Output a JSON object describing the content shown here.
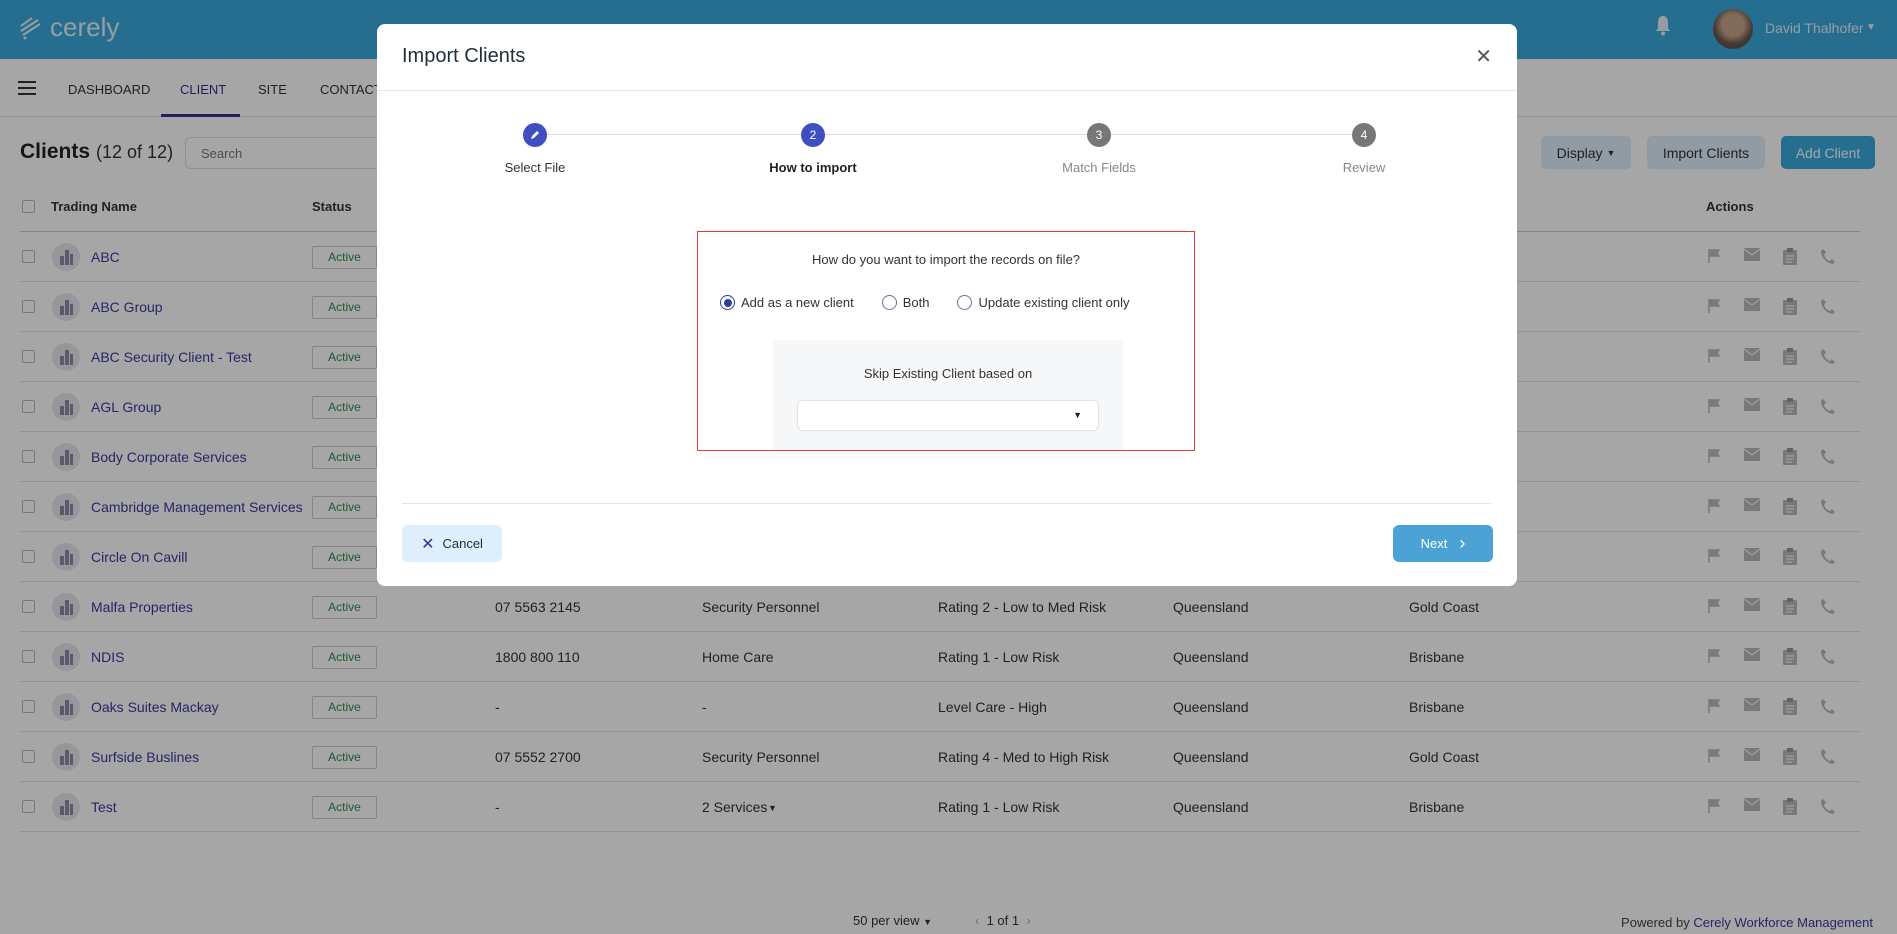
{
  "app": {
    "logo": "cerely",
    "user_name": "David Thalhofer"
  },
  "nav": {
    "items": [
      "DASHBOARD",
      "CLIENT",
      "SITE",
      "CONTACT"
    ],
    "active": "CLIENT"
  },
  "page": {
    "title": "Clients",
    "count": "(12 of 12)",
    "search_placeholder": "Search",
    "display_label": "Display",
    "import_label": "Import Clients",
    "add_label": "Add Client"
  },
  "table": {
    "headers": {
      "name": "Trading Name",
      "status": "Status",
      "actions": "Actions"
    },
    "rows": [
      {
        "name": "ABC",
        "status": "Active"
      },
      {
        "name": "ABC Group",
        "status": "Active"
      },
      {
        "name": "ABC Security Client - Test",
        "status": "Active"
      },
      {
        "name": "AGL Group",
        "status": "Active"
      },
      {
        "name": "Body Corporate Services",
        "status": "Active"
      },
      {
        "name": "Cambridge Management Services",
        "status": "Active"
      },
      {
        "name": "Circle On Cavill",
        "status": "Active"
      },
      {
        "name": "Malfa Properties",
        "status": "Active",
        "phone": "07 5563 2145",
        "industry": "Security Personnel",
        "rating": "Rating 2 - Low to Med Risk",
        "state": "Queensland",
        "city": "Gold Coast"
      },
      {
        "name": "NDIS",
        "status": "Active",
        "phone": "1800 800 110",
        "industry": "Home Care",
        "rating": "Rating 1 - Low Risk",
        "state": "Queensland",
        "city": "Brisbane"
      },
      {
        "name": "Oaks Suites Mackay",
        "status": "Active",
        "phone": "-",
        "industry": "-",
        "rating": "Level Care - High",
        "state": "Queensland",
        "city": "Brisbane"
      },
      {
        "name": "Surfside Buslines",
        "status": "Active",
        "phone": "07 5552 2700",
        "industry": "Security Personnel",
        "rating": "Rating 4 - Med to High Risk",
        "state": "Queensland",
        "city": "Gold Coast"
      },
      {
        "name": "Test",
        "status": "Active",
        "phone": "-",
        "industry": "2 Services",
        "rating": "Rating 1 - Low Risk",
        "state": "Queensland",
        "city": "Brisbane"
      }
    ]
  },
  "footer": {
    "per_view": "50 per view",
    "pagination": "1 of 1",
    "powered_prefix": "Powered by",
    "powered_link": "Cerely Workforce Management"
  },
  "modal": {
    "title": "Import Clients",
    "steps": [
      {
        "num": "1",
        "label": "Select File",
        "state": "done"
      },
      {
        "num": "2",
        "label": "How to import",
        "state": "active"
      },
      {
        "num": "3",
        "label": "Match Fields",
        "state": "pending"
      },
      {
        "num": "4",
        "label": "Review",
        "state": "pending"
      }
    ],
    "question": "How do you want to import the records on file?",
    "options": [
      {
        "label": "Add as a new client",
        "selected": true
      },
      {
        "label": "Both",
        "selected": false
      },
      {
        "label": "Update existing client only",
        "selected": false
      }
    ],
    "skip_label": "Skip Existing Client based on",
    "skip_value": "",
    "cancel_label": "Cancel",
    "next_label": "Next"
  },
  "colors": {
    "accent": "#3a2f8f",
    "primary": "#4aa3d4",
    "highlight": "#e53935"
  }
}
